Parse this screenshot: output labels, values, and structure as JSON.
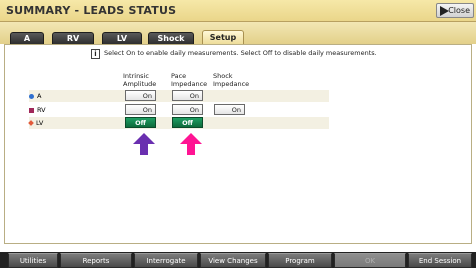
{
  "window": {
    "title": "SUMMARY - LEADS STATUS",
    "close_label": "Close"
  },
  "tabs": [
    {
      "label": "A"
    },
    {
      "label": "RV"
    },
    {
      "label": "LV"
    },
    {
      "label": "Shock"
    },
    {
      "label": "Setup",
      "active": true
    }
  ],
  "info_text": "Select On to enable daily measurements. Select Off to disable daily measurements.",
  "columns": {
    "intrinsic": [
      "Intrinsic",
      "Amplitude"
    ],
    "pace": [
      "Pace",
      "Impedance"
    ],
    "shock": [
      "Shock",
      "Impedance"
    ]
  },
  "rows": [
    {
      "label": "A",
      "marker_color": "#2f6fcf",
      "intrinsic": "On",
      "pace": "On",
      "shock": ""
    },
    {
      "label": "RV",
      "marker_color": "#a0285a",
      "intrinsic": "On",
      "pace": "On",
      "shock": "On"
    },
    {
      "label": "LV",
      "marker_color": "#e25a3a",
      "intrinsic": "Off",
      "pace": "Off",
      "shock": ""
    }
  ],
  "arrows": {
    "purple": "#6a2fb0",
    "pink": "#ff1493"
  },
  "bottom_bar": {
    "buttons": [
      "Utilities",
      "Reports",
      "Interrogate",
      "View Changes",
      "Program",
      "OK",
      "End Session"
    ]
  }
}
